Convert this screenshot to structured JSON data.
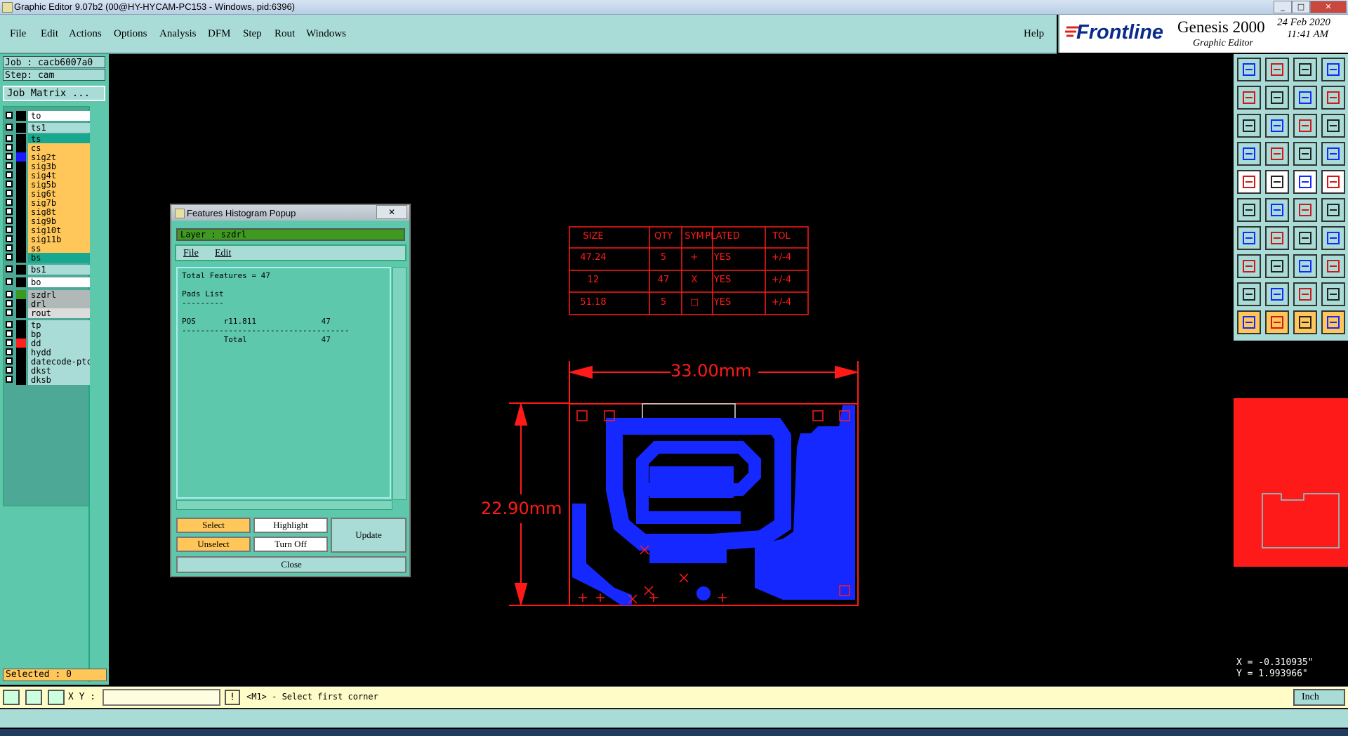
{
  "window": {
    "title": "Graphic Editor 9.07b2 (00@HY-HYCAM-PC153 - Windows, pid:6396)"
  },
  "menu": {
    "items": [
      "File",
      "Edit",
      "Actions",
      "Options",
      "Analysis",
      "DFM",
      "Step",
      "Rout",
      "Windows"
    ],
    "help": "Help"
  },
  "brand": {
    "logo": "Frontline",
    "product": "Genesis 2000",
    "subtitle": "Graphic Editor",
    "date": "24 Feb 2020",
    "time": "11:41 AM"
  },
  "job": {
    "job_label": "Job : cacb6007a0",
    "step_label": "Step: cam",
    "matrix_button": "Job Matrix ..."
  },
  "layers": [
    {
      "name": "to",
      "bg": "#ffffff",
      "swatch": "#000000"
    },
    {
      "name": "ts1",
      "bg": "#a9dcd7",
      "swatch": "#000000"
    },
    {
      "name": "ts",
      "bg": "#17a98f",
      "swatch": "#000000"
    },
    {
      "name": "cs",
      "bg": "#ffc75a",
      "swatch": "#000000"
    },
    {
      "name": "sig2t",
      "bg": "#ffc75a",
      "swatch": "#1a1aff"
    },
    {
      "name": "sig3b",
      "bg": "#ffc75a",
      "swatch": "#000000"
    },
    {
      "name": "sig4t",
      "bg": "#ffc75a",
      "swatch": "#000000"
    },
    {
      "name": "sig5b",
      "bg": "#ffc75a",
      "swatch": "#000000"
    },
    {
      "name": "sig6t",
      "bg": "#ffc75a",
      "swatch": "#000000"
    },
    {
      "name": "sig7b",
      "bg": "#ffc75a",
      "swatch": "#000000"
    },
    {
      "name": "sig8t",
      "bg": "#ffc75a",
      "swatch": "#000000"
    },
    {
      "name": "sig9b",
      "bg": "#ffc75a",
      "swatch": "#000000"
    },
    {
      "name": "sig10t",
      "bg": "#ffc75a",
      "swatch": "#000000"
    },
    {
      "name": "sig11b",
      "bg": "#ffc75a",
      "swatch": "#000000"
    },
    {
      "name": "ss",
      "bg": "#ffc75a",
      "swatch": "#000000"
    },
    {
      "name": "bs",
      "bg": "#17a98f",
      "swatch": "#000000"
    },
    {
      "name": "bs1",
      "bg": "#a9dcd7",
      "swatch": "#000000"
    },
    {
      "name": "bo",
      "bg": "#ffffff",
      "swatch": "#000000"
    },
    {
      "name": "szdrl",
      "bg": "#b0b8b8",
      "swatch": "#3a9a20"
    },
    {
      "name": "drl",
      "bg": "#b0b8b8",
      "swatch": "#000000"
    },
    {
      "name": "rout",
      "bg": "#dcdcdc",
      "swatch": "#000000"
    },
    {
      "name": "tp",
      "bg": "#a9dcd7",
      "swatch": "#000000"
    },
    {
      "name": "bp",
      "bg": "#a9dcd7",
      "swatch": "#000000"
    },
    {
      "name": "dd",
      "bg": "#a9dcd7",
      "swatch": "#ff2020"
    },
    {
      "name": "hydd",
      "bg": "#a9dcd7",
      "swatch": "#000000"
    },
    {
      "name": "datecode-ptc",
      "bg": "#a9dcd7",
      "swatch": "#000000"
    },
    {
      "name": "dkst",
      "bg": "#a9dcd7",
      "swatch": "#000000"
    },
    {
      "name": "dksb",
      "bg": "#a9dcd7",
      "swatch": "#000000"
    }
  ],
  "selected": "Selected : 0",
  "popup": {
    "title": "Features Histogram Popup",
    "layer": "Layer :  szdrl",
    "menu": [
      "File",
      "Edit"
    ],
    "lines": [
      "Total Features = 47",
      "",
      "Pads List",
      "---------",
      "",
      "POS      r11.811              47",
      "------------------------------------",
      "         Total                47"
    ],
    "buttons": {
      "select": "Select",
      "highlight": "Highlight",
      "update": "Update",
      "unselect": "Unselect",
      "turn_off": "Turn Off",
      "close": "Close"
    }
  },
  "drill_table": {
    "headers": [
      "SIZE",
      "QTY",
      "SYM",
      "PLATED",
      "TOL"
    ],
    "rows": [
      [
        "47.24",
        "5",
        "+",
        "YES",
        "+/-4"
      ],
      [
        "12",
        "47",
        "X",
        "YES",
        "+/-4"
      ],
      [
        "51.18",
        "5",
        "□",
        "YES",
        "+/-4"
      ]
    ]
  },
  "dimensions": {
    "width": "33.00mm",
    "height": "22.90mm"
  },
  "coords": {
    "x": "X = -0.310935\"",
    "y": "Y = 1.993966\""
  },
  "status": {
    "xy_label": "X Y :",
    "xy_value": "",
    "prompt": "<M1> - Select first corner",
    "units": "Inch"
  },
  "colors": {
    "menu_bg": "#a9dcd7",
    "panel_bg": "#5ec8ac",
    "drawing_red": "#ff1a1a",
    "copper_blue": "#1428ff"
  }
}
